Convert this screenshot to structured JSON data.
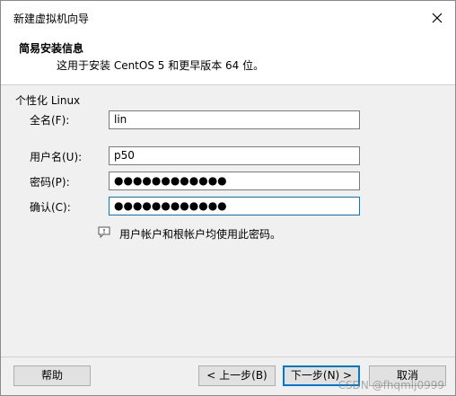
{
  "window": {
    "title": "新建虚拟机向导"
  },
  "header": {
    "title": "简易安装信息",
    "subtitle": "这用于安装 CentOS 5 和更早版本 64 位。"
  },
  "section": {
    "label": "个性化 Linux"
  },
  "fields": {
    "fullname_label": "全名(F):",
    "fullname_value": "lin",
    "username_label": "用户名(U):",
    "username_value": "p50",
    "password_label": "密码(P):",
    "password_value": "●●●●●●●●●●●●",
    "confirm_label": "确认(C):",
    "confirm_value": "●●●●●●●●●●●●"
  },
  "info": {
    "text": "用户帐户和根帐户均使用此密码。",
    "icon": "comment-info-icon"
  },
  "buttons": {
    "help": "帮助",
    "back": "< 上一步(B)",
    "next": "下一步(N) >",
    "cancel": "取消"
  },
  "watermark": "CSDN @fhqmlj0999",
  "colors": {
    "focus_border": "#0078d7",
    "dialog_bg": "#f0f0f0"
  }
}
